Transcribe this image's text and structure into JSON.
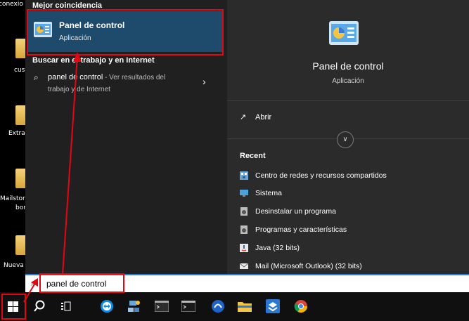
{
  "desktop": {
    "icons": [
      {
        "label": "conexio"
      },
      {
        "label": "cust"
      },
      {
        "label": "Extrac"
      },
      {
        "label": "Mailstorb"
      },
      {
        "label": "bor"
      },
      {
        "label": "Nueva"
      }
    ]
  },
  "search": {
    "best_match_heading": "Mejor coincidencia",
    "best_match": {
      "title": "Panel de control",
      "subtitle": "Aplicación"
    },
    "web_heading": "Buscar en el trabajo y en Internet",
    "web_result": {
      "query": "panel de control",
      "suffix": " - Ver resultados del",
      "suffix2": "trabajo y de Internet"
    },
    "query": "panel de control"
  },
  "preview": {
    "title": "Panel de control",
    "subtitle": "Aplicación",
    "open_label": "Abrir",
    "recent_heading": "Recent",
    "recent": [
      {
        "label": "Centro de redes y recursos compartidos",
        "icon": "network-icon"
      },
      {
        "label": "Sistema",
        "icon": "system-icon"
      },
      {
        "label": "Desinstalar un programa",
        "icon": "programs-icon"
      },
      {
        "label": "Programas y características",
        "icon": "programs-icon"
      },
      {
        "label": "Java (32 bits)",
        "icon": "java-icon"
      },
      {
        "label": "Mail (Microsoft Outlook) (32 bits)",
        "icon": "mail-icon"
      }
    ]
  },
  "taskbar": {
    "items": [
      "start-icon",
      "search-icon",
      "task-view-icon",
      "teamviewer-icon",
      "network-app-icon",
      "terminal-icon",
      "cmd-icon",
      "app-icon",
      "file-explorer-icon",
      "app-store-icon",
      "chrome-icon"
    ]
  },
  "colors": {
    "highlight": "#1e4a6b",
    "annotation": "#e30613",
    "search_border": "#2a7dd3"
  }
}
